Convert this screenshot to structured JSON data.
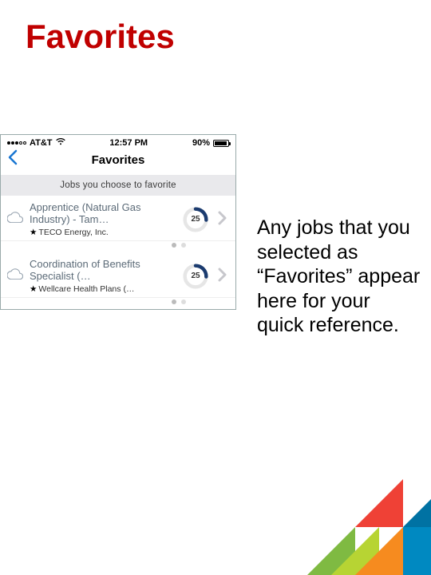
{
  "slide": {
    "title": "Favorites",
    "description": "Any jobs that you selected as “Favorites” appear here for your quick reference."
  },
  "phone": {
    "status": {
      "carrier": "AT&T",
      "time": "12:57 PM",
      "battery_pct": "90%"
    },
    "nav": {
      "title": "Favorites"
    },
    "subheader": "Jobs you choose to favorite",
    "jobs": [
      {
        "title": "Apprentice (Natural Gas Industry) - Tam…",
        "company": "TECO Energy, Inc.",
        "score": "25"
      },
      {
        "title": "Coordination of Benefits Specialist (…",
        "company": "Wellcare Health Plans (…",
        "score": "25"
      }
    ]
  }
}
